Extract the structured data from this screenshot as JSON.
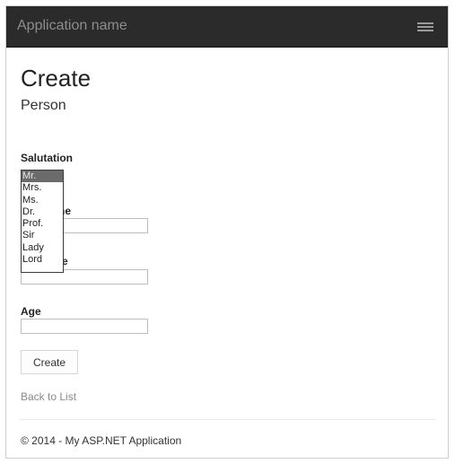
{
  "navbar": {
    "brand": "Application name",
    "toggle_icon": "hamburger-menu-icon"
  },
  "page": {
    "title": "Create",
    "subtitle": "Person"
  },
  "form": {
    "salutation_label": "Salutation",
    "salutation_options": [
      "Mr.",
      "Mrs.",
      "Ms.",
      "Dr.",
      "Prof.",
      "Sir",
      "Lady",
      "Lord"
    ],
    "salutation_selected": "Mr.",
    "first_name_label_visible": "he",
    "last_name_label_visible": "e",
    "first_name_value": "",
    "last_name_value": "",
    "age_label": "Age",
    "age_value": "",
    "submit_label": "Create"
  },
  "links": {
    "back_to_list": "Back to List"
  },
  "footer": {
    "text": "© 2014 - My ASP.NET Application"
  },
  "colors": {
    "navbar_bg": "#2b2b2b",
    "selected_option_bg": "#6b6b6b"
  }
}
